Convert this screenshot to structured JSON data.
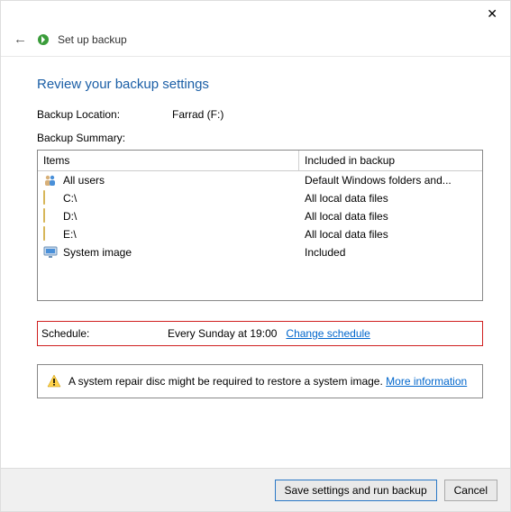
{
  "title": "Set up backup",
  "heading": "Review your backup settings",
  "backup_location_label": "Backup Location:",
  "backup_location_value": "Farrad (F:)",
  "backup_summary_label": "Backup Summary:",
  "columns": {
    "items": "Items",
    "included": "Included in backup"
  },
  "items": [
    {
      "icon": "people",
      "name": "All users",
      "included": "Default Windows folders and..."
    },
    {
      "icon": "folder",
      "name": "C:\\",
      "included": "All local data files"
    },
    {
      "icon": "folder",
      "name": "D:\\",
      "included": "All local data files"
    },
    {
      "icon": "folder",
      "name": "E:\\",
      "included": "All local data files"
    },
    {
      "icon": "monitor",
      "name": "System image",
      "included": "Included"
    }
  ],
  "schedule_label": "Schedule:",
  "schedule_value": "Every Sunday at 19:00",
  "change_schedule": "Change schedule",
  "info_text": "A system repair disc might be required to restore a system image. ",
  "more_info": "More information",
  "buttons": {
    "save": "Save settings and run backup",
    "cancel": "Cancel"
  }
}
